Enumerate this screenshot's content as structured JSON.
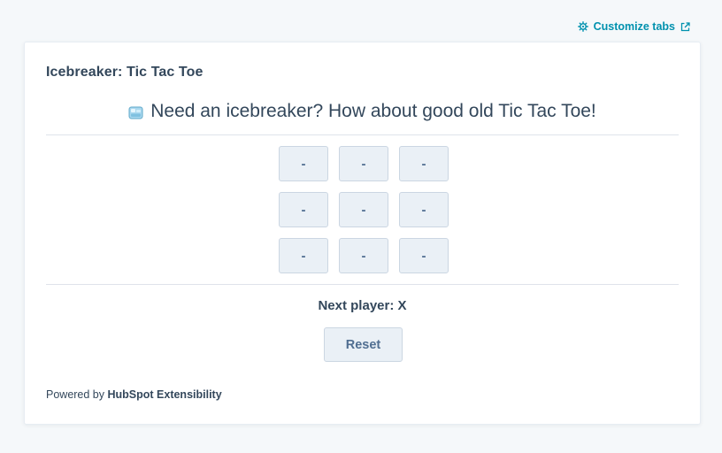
{
  "header": {
    "customize_label": "Customize tabs",
    "customize_icon": "gear-icon",
    "external_icon": "external-link-icon",
    "link_color": "#0091ae"
  },
  "card": {
    "title": "Icebreaker: Tic Tac Toe",
    "headline": "Need an icebreaker? How about good old Tic Tac Toe!",
    "headline_icon": "ice-cube-icon",
    "board": [
      [
        "-",
        "-",
        "-"
      ],
      [
        "-",
        "-",
        "-"
      ],
      [
        "-",
        "-",
        "-"
      ]
    ],
    "status_text": "Next player: X",
    "reset_label": "Reset",
    "footer": {
      "prefix": "Powered by ",
      "brand": "HubSpot Extensibility"
    }
  },
  "colors": {
    "background": "#f5f8fa",
    "text": "#33475b",
    "button_bg": "#eaf0f6",
    "button_border": "#cbd6e2",
    "button_text": "#506e91"
  }
}
